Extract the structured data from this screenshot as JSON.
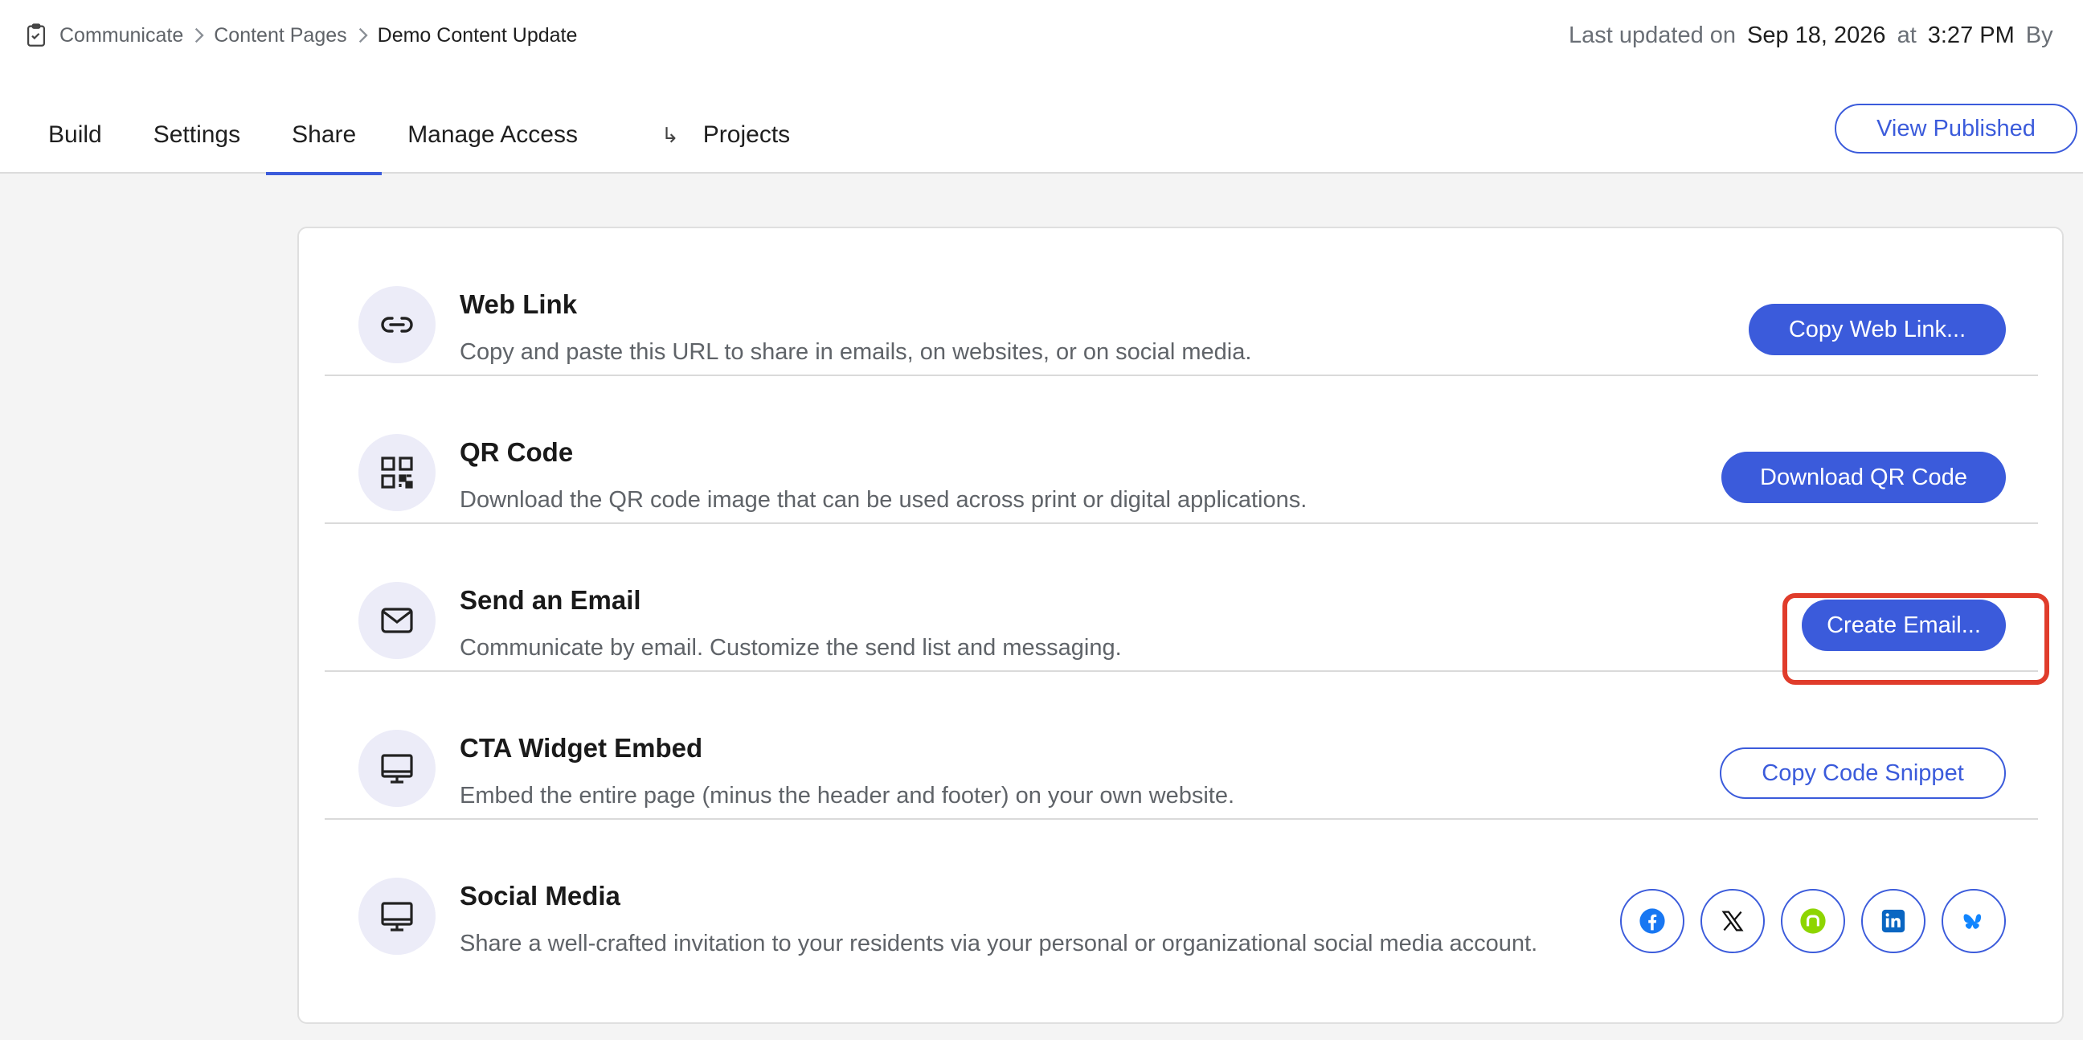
{
  "breadcrumb": {
    "items": [
      "Communicate",
      "Content Pages"
    ],
    "current": "Demo Content Update"
  },
  "last_updated": {
    "prefix": "Last updated on",
    "date": "Sep 18, 2026",
    "at": "at",
    "time": "3:27 PM",
    "by": "By"
  },
  "tabs": [
    {
      "label": "Build",
      "active": false
    },
    {
      "label": "Settings",
      "active": false
    },
    {
      "label": "Share",
      "active": true
    },
    {
      "label": "Manage Access",
      "active": false
    },
    {
      "label": "Projects",
      "active": false,
      "icon": "arrow-return-icon"
    }
  ],
  "view_published_label": "View Published",
  "share_options": [
    {
      "title": "Web Link",
      "description": "Copy and paste this URL to share in emails, on websites, or on social media.",
      "icon": "link-icon",
      "button": "Copy Web Link..."
    },
    {
      "title": "QR Code",
      "description": "Download the QR code image that can be used across print or digital applications.",
      "icon": "qr-code-icon",
      "button": "Download QR Code"
    },
    {
      "title": "Send an Email",
      "description": "Communicate by email. Customize the send list and messaging.",
      "icon": "envelope-icon",
      "button": "Create Email..."
    },
    {
      "title": "CTA Widget Embed",
      "description": "Embed the entire page (minus the header and footer) on your own website.",
      "icon": "monitor-icon",
      "button": "Copy Code Snippet"
    },
    {
      "title": "Social Media",
      "description": "Share a well-crafted invitation to your residents via your personal or organizational social media account.",
      "icon": "monitor-icon",
      "social": [
        "facebook-icon",
        "x-icon",
        "nextdoor-icon",
        "linkedin-icon",
        "bluesky-icon"
      ]
    }
  ],
  "colors": {
    "accent": "#3b5bdb",
    "highlight": "#e03c2b",
    "nextdoor": "#8ed500",
    "linkedin": "#0a66c2",
    "facebook": "#1877f2"
  }
}
